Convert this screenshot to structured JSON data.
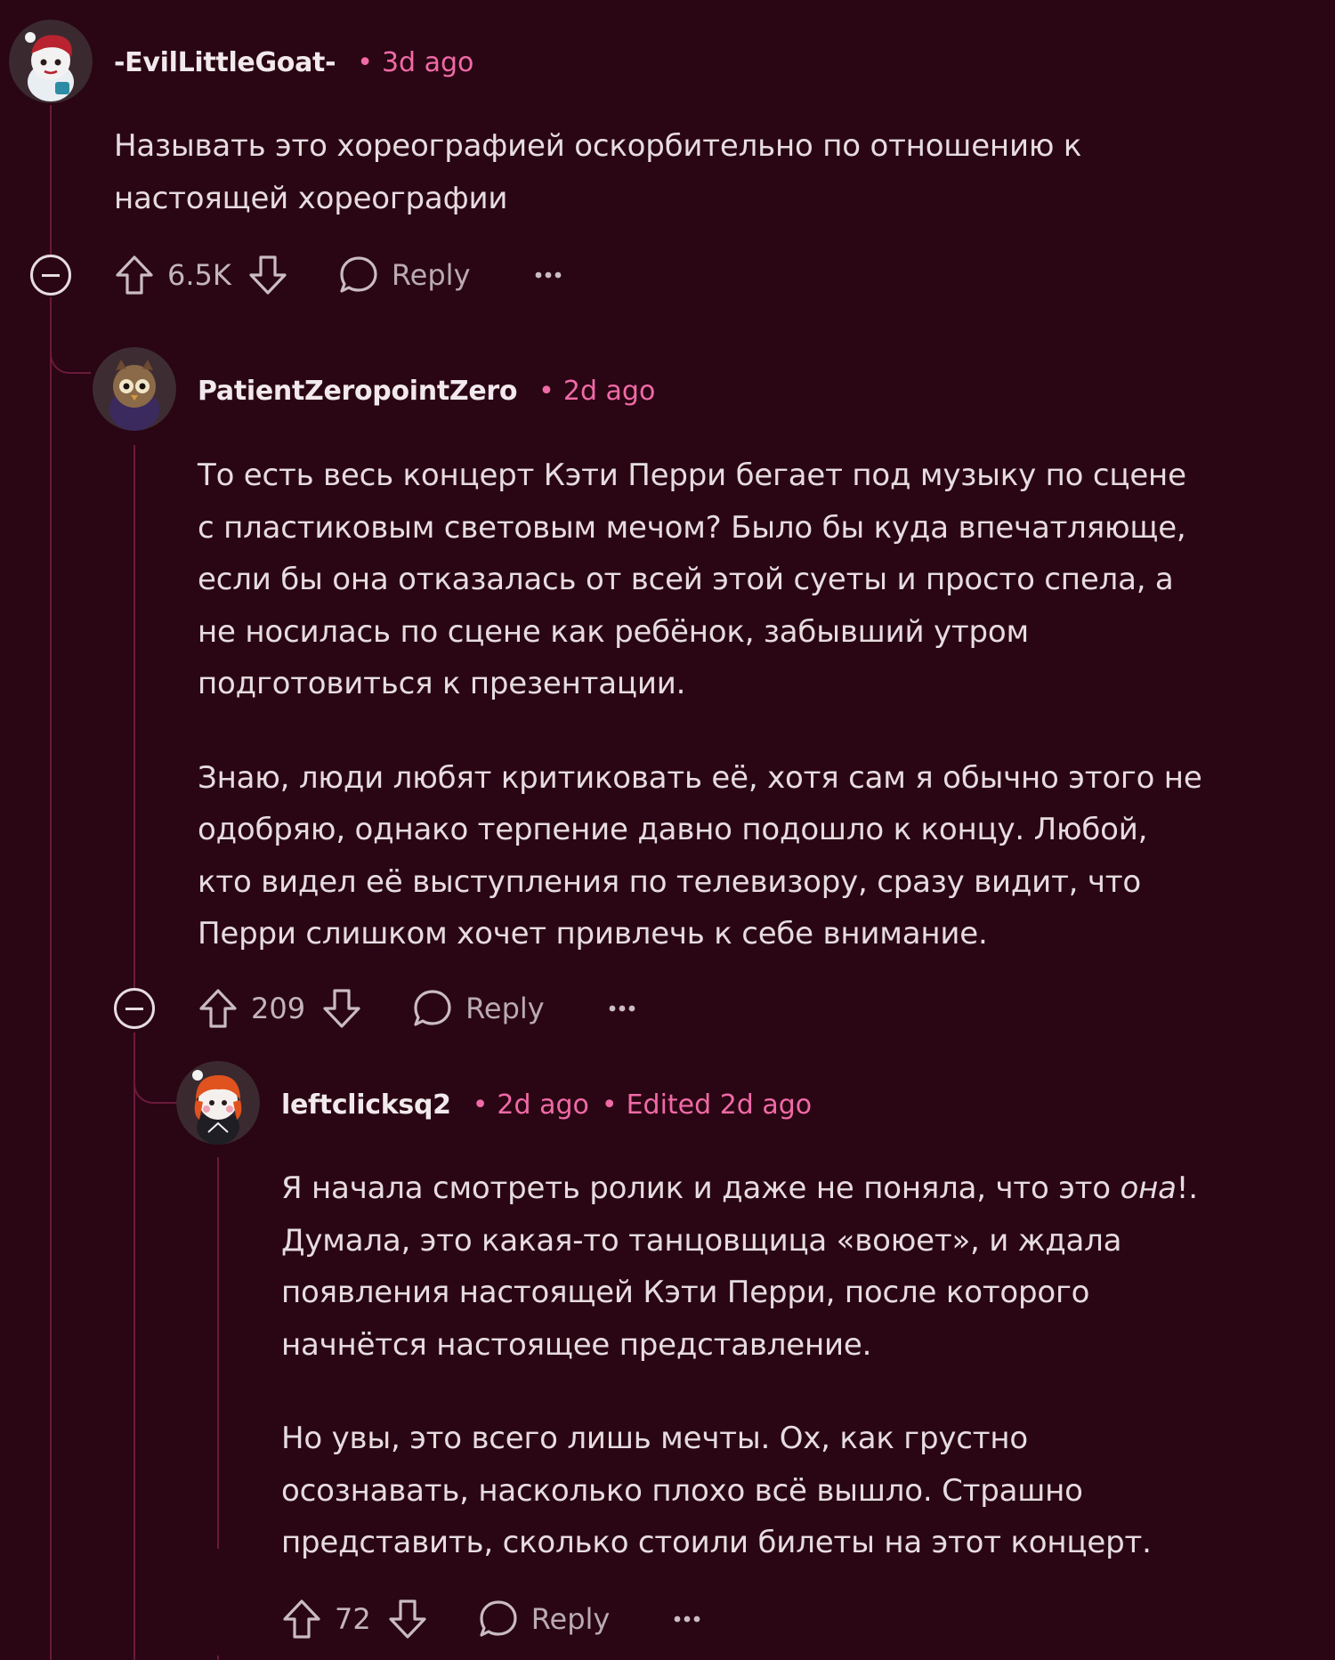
{
  "comments": [
    {
      "username": "-EvilLittleGoat-",
      "time": "3d ago",
      "edited": "",
      "paragraphs": [
        "Называть это хореографией оскорбительно по отношению к\nнастоящей хореографии"
      ],
      "votes": "6.5K",
      "reply_label": "Reply"
    },
    {
      "username": "PatientZeropointZero",
      "time": "2d ago",
      "edited": "",
      "paragraphs": [
        "То есть весь концерт Кэти Перри бегает под музыку по сцене\nс пластиковым световым мечом? Было бы куда впечатляюще,\nесли бы она отказалась от всей этой суеты и просто спела, а\nне носилась по сцене как ребёнок, забывший утром\nподготовиться к презентации.",
        "Знаю, люди любят критиковать её, хотя сам я обычно этого не\nодобряю, однако терпение давно подошло к концу. Любой,\nкто видел её выступления по телевизору, сразу видит, что\nПерри слишком хочет привлечь к себе внимание."
      ],
      "votes": "209",
      "reply_label": "Reply"
    },
    {
      "username": "leftclicksq2",
      "time": "2d ago",
      "edited": "Edited 2d ago",
      "paragraph1_before": "Я начала смотреть ролик и даже не поняла, что это ",
      "paragraph1_em": "она",
      "paragraph1_after": "!.\nДумала, это какая-то танцовщица «воюет», и ждала\nпоявления настоящей Кэти Перри, после которого\nначнётся настоящее представление.",
      "paragraph2": "Но увы, это всего лишь мечты. Ох, как грустно\nосознавать, насколько плохо всё вышло. Страшно\nпредставить, сколько стоили билеты на этот концерт.",
      "votes": "72",
      "reply_label": "Reply"
    }
  ],
  "colors": {
    "background": "#2a0513",
    "thread_line": "#6a1a3a",
    "timestamp": "#f06aa7",
    "text": "#e6dce0",
    "muted": "#b9abb1"
  },
  "icons": [
    "avatar",
    "collapse-icon",
    "upvote-icon",
    "downvote-icon",
    "comment-bubble-icon",
    "more-options-icon"
  ]
}
